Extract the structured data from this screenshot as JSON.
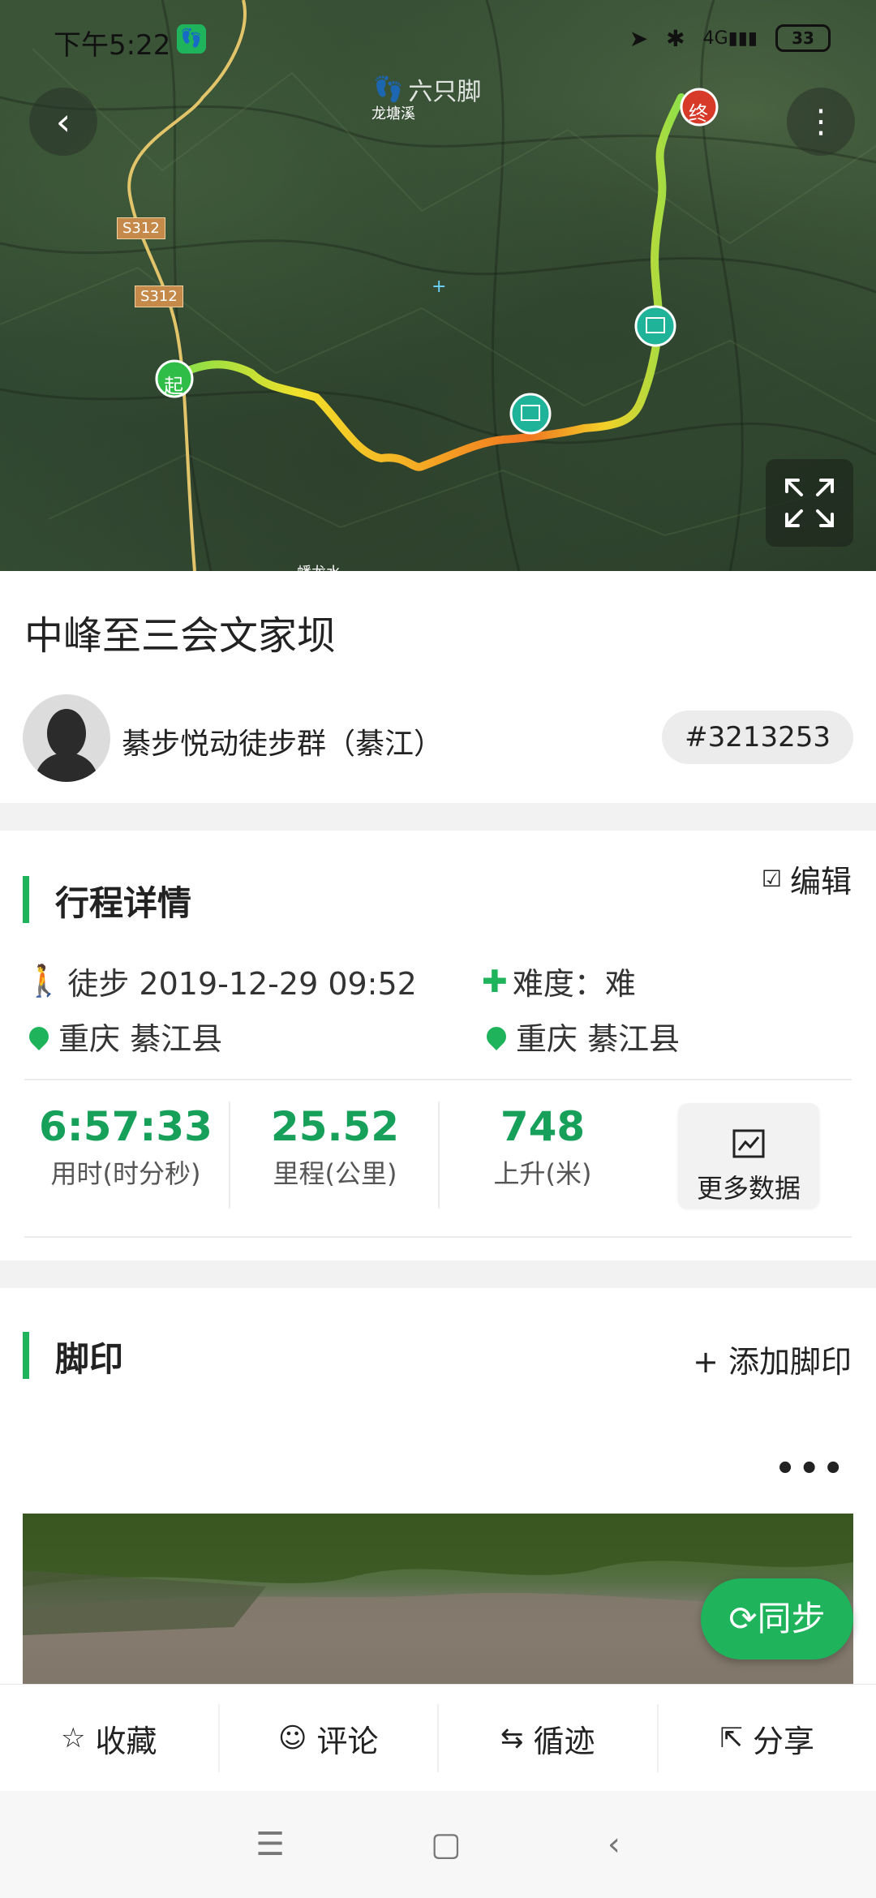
{
  "status_bar": {
    "time": "下午5:22",
    "battery": "33",
    "network": "4G"
  },
  "map": {
    "watermark": "六只脚",
    "places": [
      "龙塘溪",
      "蟠龙水"
    ],
    "roads": [
      "S312",
      "S312"
    ],
    "start_marker": "起",
    "end_marker": "终"
  },
  "header": {
    "route_title": "中峰至三会文家坝",
    "author": "綦步悦动徒步群（綦江）",
    "route_id": "#3213253"
  },
  "details": {
    "section_title": "行程详情",
    "edit_label": "编辑",
    "activity": "徒步 2019-12-29 09:52",
    "difficulty": "难度：难",
    "start_location": "重庆 綦江县",
    "end_location": "重庆 綦江县",
    "start_badge": "起",
    "end_badge": "终",
    "stats": [
      {
        "value": "6:57:33",
        "label": "用时(时分秒)"
      },
      {
        "value": "25.52",
        "label": "里程(公里)"
      },
      {
        "value": "748",
        "label": "上升(米)"
      }
    ],
    "more_data_label": "更多数据"
  },
  "footprint": {
    "section_title": "脚印",
    "add_label": "+ 添加脚印",
    "menu_dots": "•••",
    "sync_label": "同步"
  },
  "actions": {
    "favorite": "收藏",
    "comment": "评论",
    "follow_track": "循迹",
    "share": "分享"
  },
  "colors": {
    "accent": "#1fb35b",
    "stat_green": "#17a05a"
  }
}
